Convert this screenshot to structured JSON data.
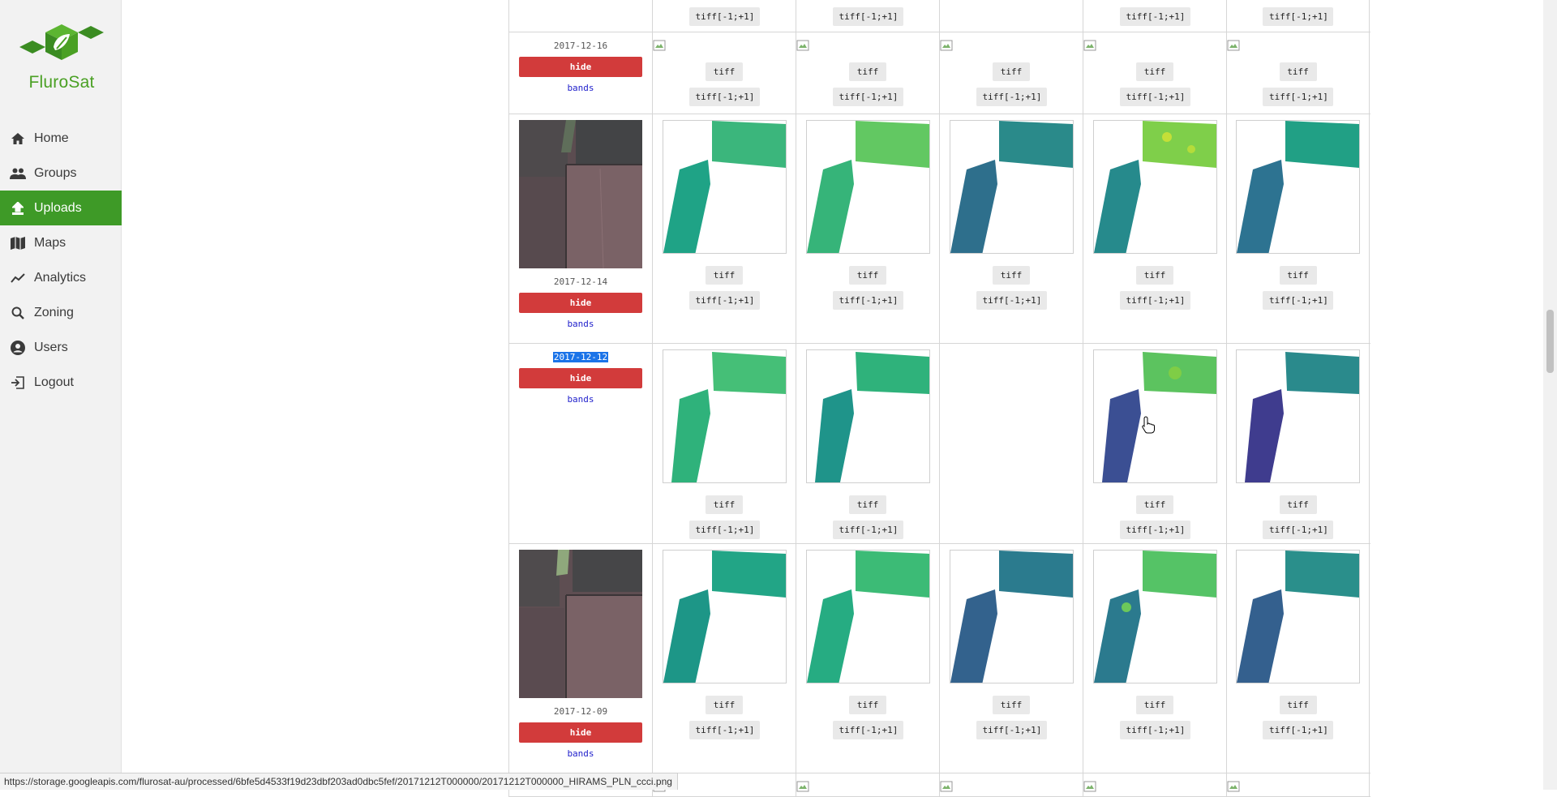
{
  "brand": {
    "name": "FluroSat"
  },
  "nav": [
    {
      "label": "Home",
      "icon": "home-icon",
      "active": false
    },
    {
      "label": "Groups",
      "icon": "groups-icon",
      "active": false
    },
    {
      "label": "Uploads",
      "icon": "upload-icon",
      "active": true
    },
    {
      "label": "Maps",
      "icon": "map-icon",
      "active": false
    },
    {
      "label": "Analytics",
      "icon": "analytics-icon",
      "active": false
    },
    {
      "label": "Zoning",
      "icon": "search-icon",
      "active": false
    },
    {
      "label": "Users",
      "icon": "user-icon",
      "active": false
    },
    {
      "label": "Logout",
      "icon": "logout-icon",
      "active": false
    }
  ],
  "buttons": {
    "hide": "hide",
    "bands": "bands",
    "tiff": "tiff",
    "tiff_range": "tiff[-1;+1]"
  },
  "rows": [
    {
      "date": "",
      "selected": false
    },
    {
      "date": "2017-12-16",
      "selected": false
    },
    {
      "date": "2017-12-14",
      "selected": false
    },
    {
      "date": "2017-12-12",
      "selected": true
    },
    {
      "date": "2017-12-09",
      "selected": false
    }
  ],
  "colors": {
    "accent": "#3e9a27",
    "hide_button": "#d23b3b",
    "link": "#2222cc",
    "selection": "#1a73e8"
  },
  "status_bar": {
    "url": "https://storage.googleapis.com/flurosat-au/processed/6bfe5d4533f19d23dbf203ad0dbc5fef/20171212T000000/20171212T000000_HIRAMS_PLN_ccci.png"
  }
}
